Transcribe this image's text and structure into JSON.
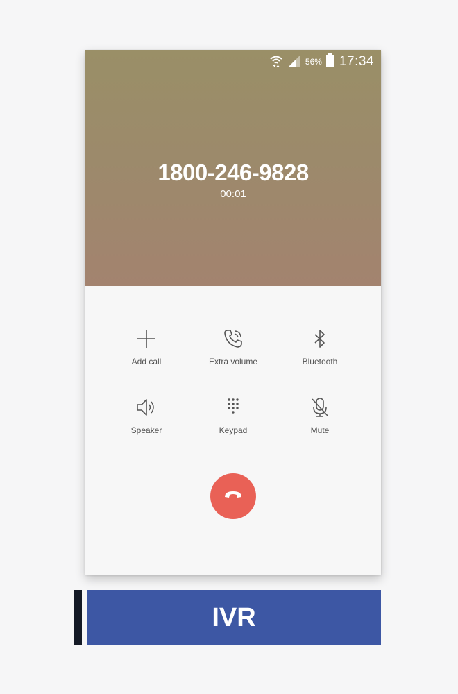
{
  "status_bar": {
    "battery_percent": "56%",
    "time": "17:34",
    "icons": [
      "wifi-icon",
      "signal-icon",
      "battery-icon"
    ]
  },
  "call": {
    "number": "1800-246-9828",
    "duration": "00:01"
  },
  "actions": [
    {
      "label": "Add call",
      "icon": "plus-icon"
    },
    {
      "label": "Extra volume",
      "icon": "phone-volume-icon"
    },
    {
      "label": "Bluetooth",
      "icon": "bluetooth-icon"
    },
    {
      "label": "Speaker",
      "icon": "speaker-icon"
    },
    {
      "label": "Keypad",
      "icon": "keypad-icon"
    },
    {
      "label": "Mute",
      "icon": "mic-off-icon"
    }
  ],
  "end_call": {
    "icon": "hang-up-icon",
    "color": "#e96156"
  },
  "banner": {
    "label": "IVR",
    "color": "#3d57a4"
  },
  "colors": {
    "header_top": "#9a8f67",
    "header_bottom": "#a3836f"
  }
}
